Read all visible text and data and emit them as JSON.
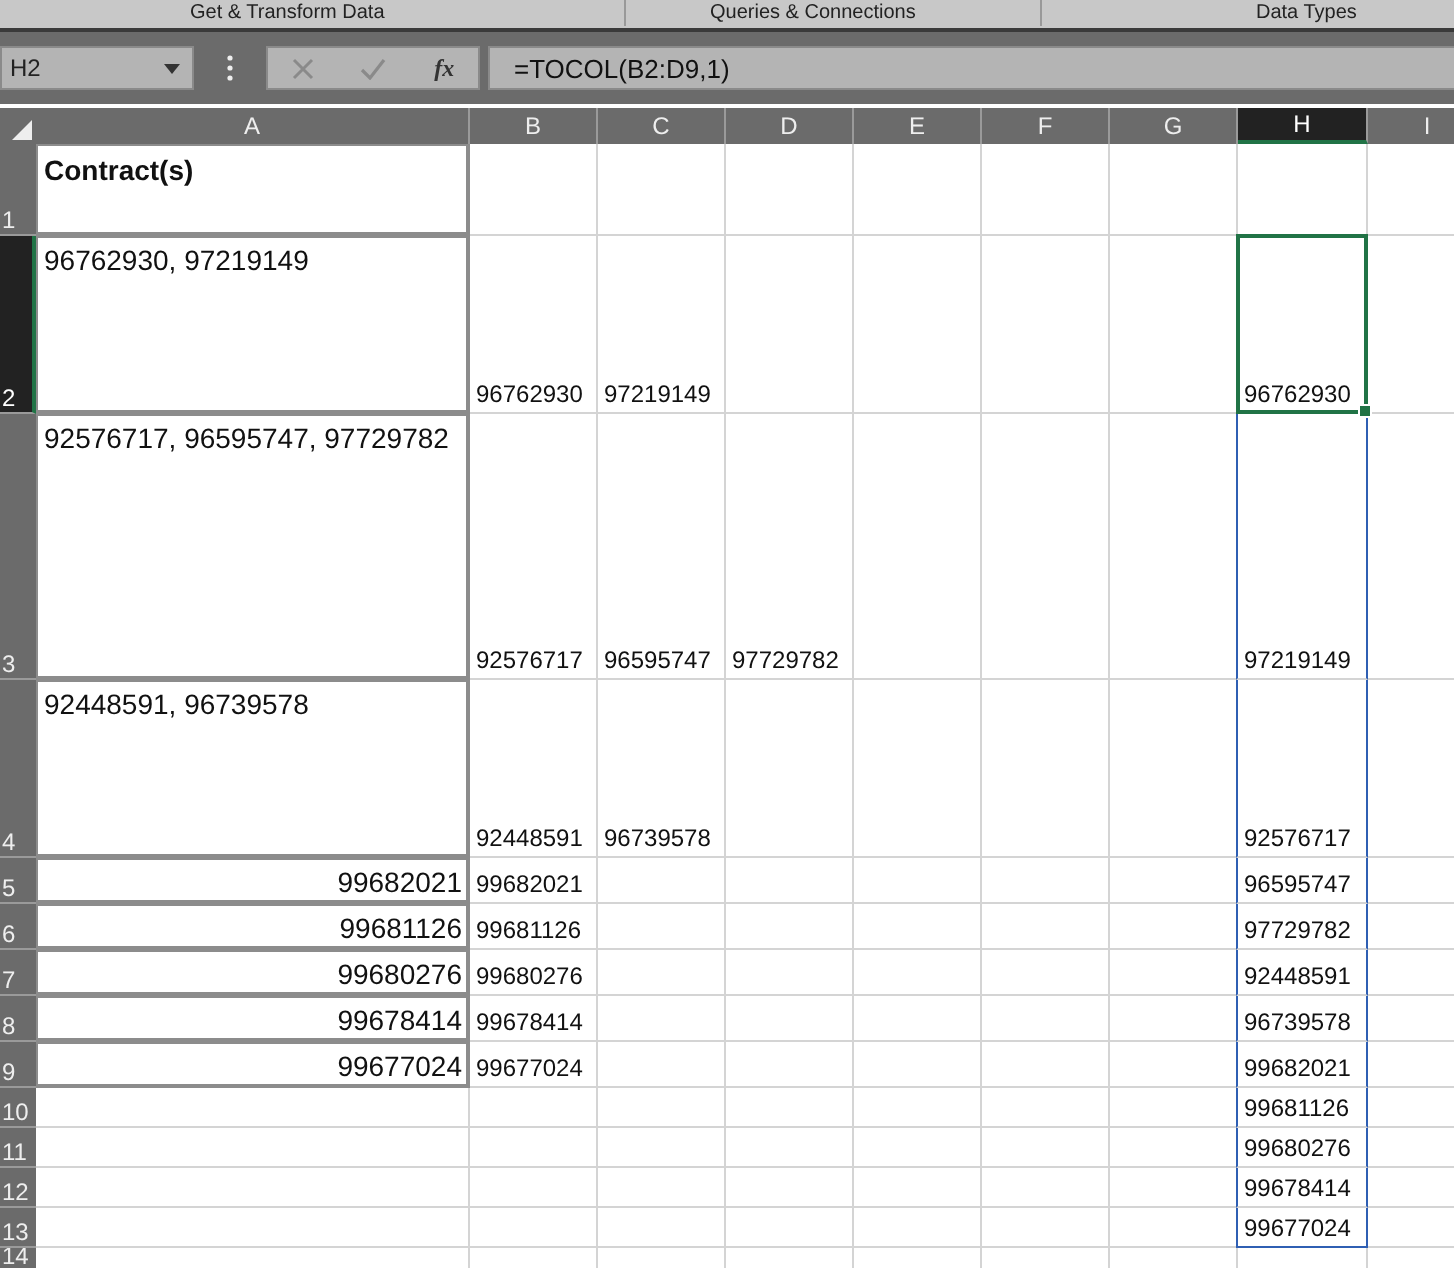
{
  "ribbon_groups": [
    "Get & Transform Data",
    "Queries & Connections",
    "Data Types"
  ],
  "name_box": {
    "value": "H2"
  },
  "formula_bar": {
    "fx": "fx",
    "value": "=TOCOL(B2:D9,1)"
  },
  "columns": [
    {
      "label": "A",
      "selected": false
    },
    {
      "label": "B",
      "selected": false
    },
    {
      "label": "C",
      "selected": false
    },
    {
      "label": "D",
      "selected": false
    },
    {
      "label": "E",
      "selected": false
    },
    {
      "label": "F",
      "selected": false
    },
    {
      "label": "G",
      "selected": false
    },
    {
      "label": "H",
      "selected": true
    },
    {
      "label": "I",
      "selected": false
    }
  ],
  "rows": [
    {
      "label": "1",
      "selected": false,
      "kind": "header",
      "spill": false,
      "cells": {
        "A": "Contract(s)"
      }
    },
    {
      "label": "2",
      "selected": true,
      "kind": "wrapped",
      "spill": true,
      "cells": {
        "A": "96762930, 97219149",
        "B": "96762930",
        "C": "97219149",
        "H": "96762930"
      }
    },
    {
      "label": "3",
      "selected": false,
      "kind": "wrapped",
      "spill": true,
      "cells": {
        "A": "92576717, 96595747, 97729782",
        "B": "92576717",
        "C": "96595747",
        "D": "97729782",
        "H": "97219149"
      }
    },
    {
      "label": "4",
      "selected": false,
      "kind": "wrapped",
      "spill": true,
      "cells": {
        "A": "92448591, 96739578",
        "B": "92448591",
        "C": "96739578",
        "H": "92576717"
      }
    },
    {
      "label": "5",
      "selected": false,
      "kind": "number",
      "spill": true,
      "cells": {
        "A": "99682021",
        "B": "99682021",
        "H": "96595747"
      }
    },
    {
      "label": "6",
      "selected": false,
      "kind": "number",
      "spill": true,
      "cells": {
        "A": "99681126",
        "B": "99681126",
        "H": "97729782"
      }
    },
    {
      "label": "7",
      "selected": false,
      "kind": "number",
      "spill": true,
      "cells": {
        "A": "99680276",
        "B": "99680276",
        "H": "92448591"
      }
    },
    {
      "label": "8",
      "selected": false,
      "kind": "number",
      "spill": true,
      "cells": {
        "A": "99678414",
        "B": "99678414",
        "H": "96739578"
      }
    },
    {
      "label": "9",
      "selected": false,
      "kind": "number",
      "spill": true,
      "cells": {
        "A": "99677024",
        "B": "99677024",
        "H": "99682021"
      }
    },
    {
      "label": "10",
      "selected": false,
      "kind": "empty",
      "spill": true,
      "cells": {
        "H": "99681126"
      }
    },
    {
      "label": "11",
      "selected": false,
      "kind": "empty",
      "spill": true,
      "cells": {
        "H": "99680276"
      }
    },
    {
      "label": "12",
      "selected": false,
      "kind": "empty",
      "spill": true,
      "cells": {
        "H": "99678414"
      }
    },
    {
      "label": "13",
      "selected": false,
      "kind": "empty",
      "spill": true,
      "cells": {
        "H": "99677024"
      }
    },
    {
      "label": "14",
      "selected": false,
      "kind": "empty",
      "spill": false,
      "cells": {}
    }
  ]
}
